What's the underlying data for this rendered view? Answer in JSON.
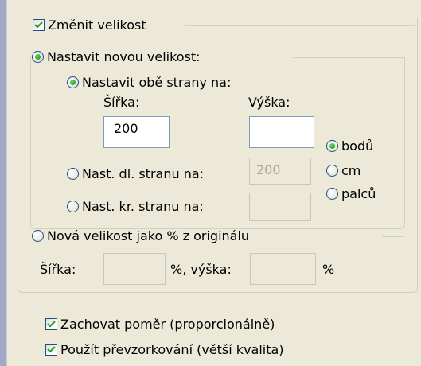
{
  "resize_checkbox": {
    "label": "Změnit velikost",
    "checked": true
  },
  "new_size_radio": {
    "label": "Nastavit novou velikost:",
    "selected": true
  },
  "both_sides_radio": {
    "label": "Nastavit obě strany na:",
    "selected": true
  },
  "width_label": "Šířka:",
  "height_label": "Výška:",
  "width_value": "200",
  "height_value": "",
  "long_side_radio": {
    "label": "Nast. dl. stranu na:",
    "selected": false
  },
  "long_side_value": "200",
  "short_side_radio": {
    "label": "Nast. kr. stranu na:",
    "selected": false
  },
  "short_side_value": "",
  "units": [
    {
      "label": "bodů",
      "selected": true
    },
    {
      "label": "cm",
      "selected": false
    },
    {
      "label": "palců",
      "selected": false
    }
  ],
  "percent_radio": {
    "label": "Nová velikost jako % z originálu",
    "selected": false
  },
  "percent_width_label": "Šířka:",
  "percent_height_label": "%, výška:",
  "percent_suffix": "%",
  "keep_ratio_checkbox": {
    "label": "Zachovat poměr (proporcionálně)",
    "checked": true
  },
  "resample_checkbox": {
    "label": "Použít převzorkování (větší kvalita)",
    "checked": true
  }
}
